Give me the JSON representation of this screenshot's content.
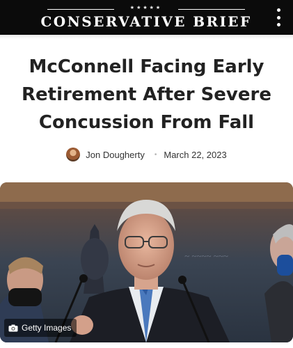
{
  "header": {
    "brand_stars": "★★★★★",
    "brand_name": "CONSERVATIVE BRIEF",
    "menu_icon": "more-vertical-icon"
  },
  "article": {
    "title": "McConnell Facing Early Retirement After Severe Concussion From Fall",
    "author": "Jon Dougherty",
    "separator": "•",
    "date": "March 22, 2023",
    "image_credit": "Getty Images",
    "credit_icon": "camera-icon"
  },
  "colors": {
    "header_bg": "#0b0b0b",
    "headline": "#222222",
    "text": "#333333"
  }
}
